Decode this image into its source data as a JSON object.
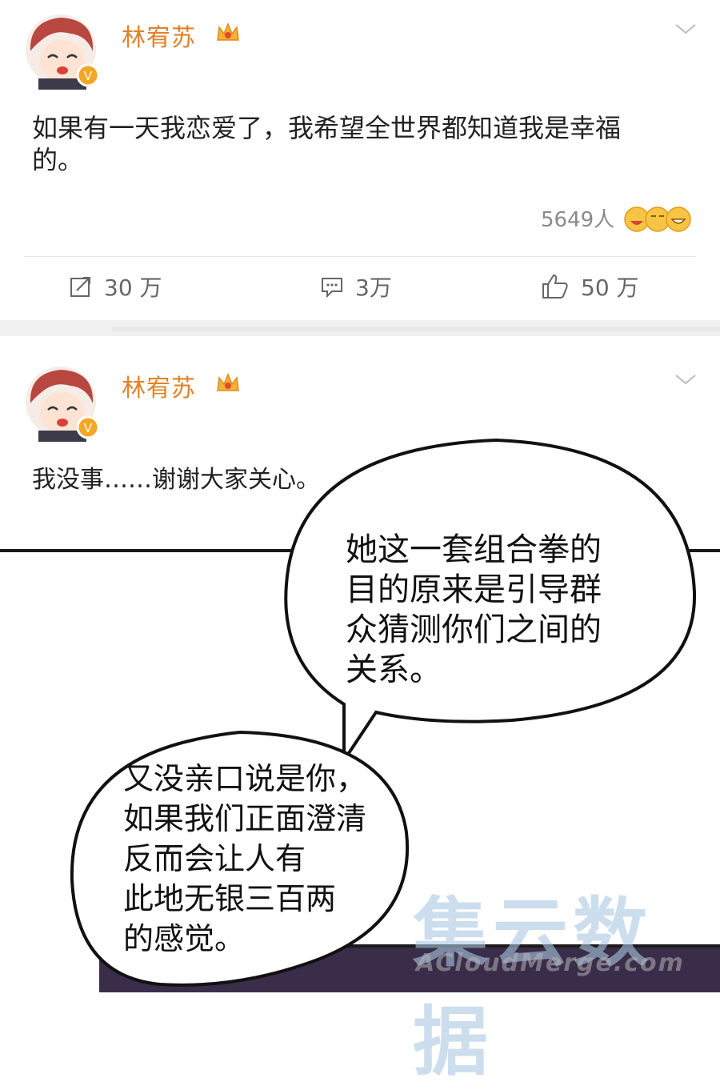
{
  "posts": [
    {
      "username": "林宥苏",
      "text": "如果有一天我恋爱了，我希望全世界都知道我是幸福的。",
      "reactions": "5649人",
      "repost": "30 万",
      "comment": "3万",
      "like": "50 万"
    },
    {
      "username": "林宥苏",
      "text": "我没事……谢谢大家关心。"
    }
  ],
  "comic": {
    "bubble1": "她这一套组合拳的\n目的原来是引导群\n众猜测你们之间的\n关系。",
    "bubble2": "又没亲口说是你，\n如果我们正面澄清\n反而会让人有\n此地无银三百两\n的感觉。"
  },
  "watermark": {
    "main": "集云数据",
    "sub": "ACloudMerge.com"
  },
  "colors": {
    "username": "#e1822c",
    "gap": "#f1f1f1"
  }
}
